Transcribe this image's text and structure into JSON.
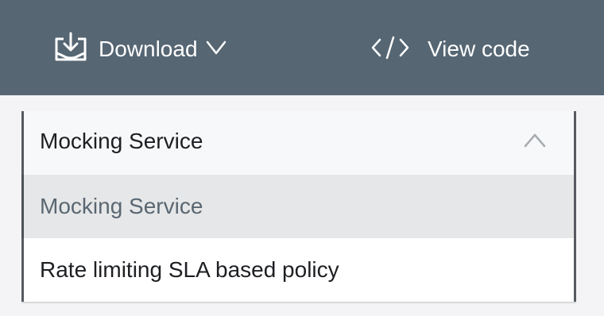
{
  "toolbar": {
    "download_label": "Download",
    "view_code_label": "View code",
    "download_icon": "download-tray-icon",
    "chevron_icon": "chevron-down-icon",
    "code_icon": "code-brackets-icon"
  },
  "dropdown": {
    "selected": "Mocking Service",
    "chevron_icon": "chevron-up-icon",
    "options": [
      {
        "label": "Mocking Service",
        "highlighted": true
      },
      {
        "label": "Rate limiting SLA based policy",
        "highlighted": false
      }
    ]
  },
  "colors": {
    "toolbar_bg": "#566673",
    "highlight_bg": "#e6e7e8",
    "text": "#1d1f22",
    "muted_text": "#5a6772"
  }
}
